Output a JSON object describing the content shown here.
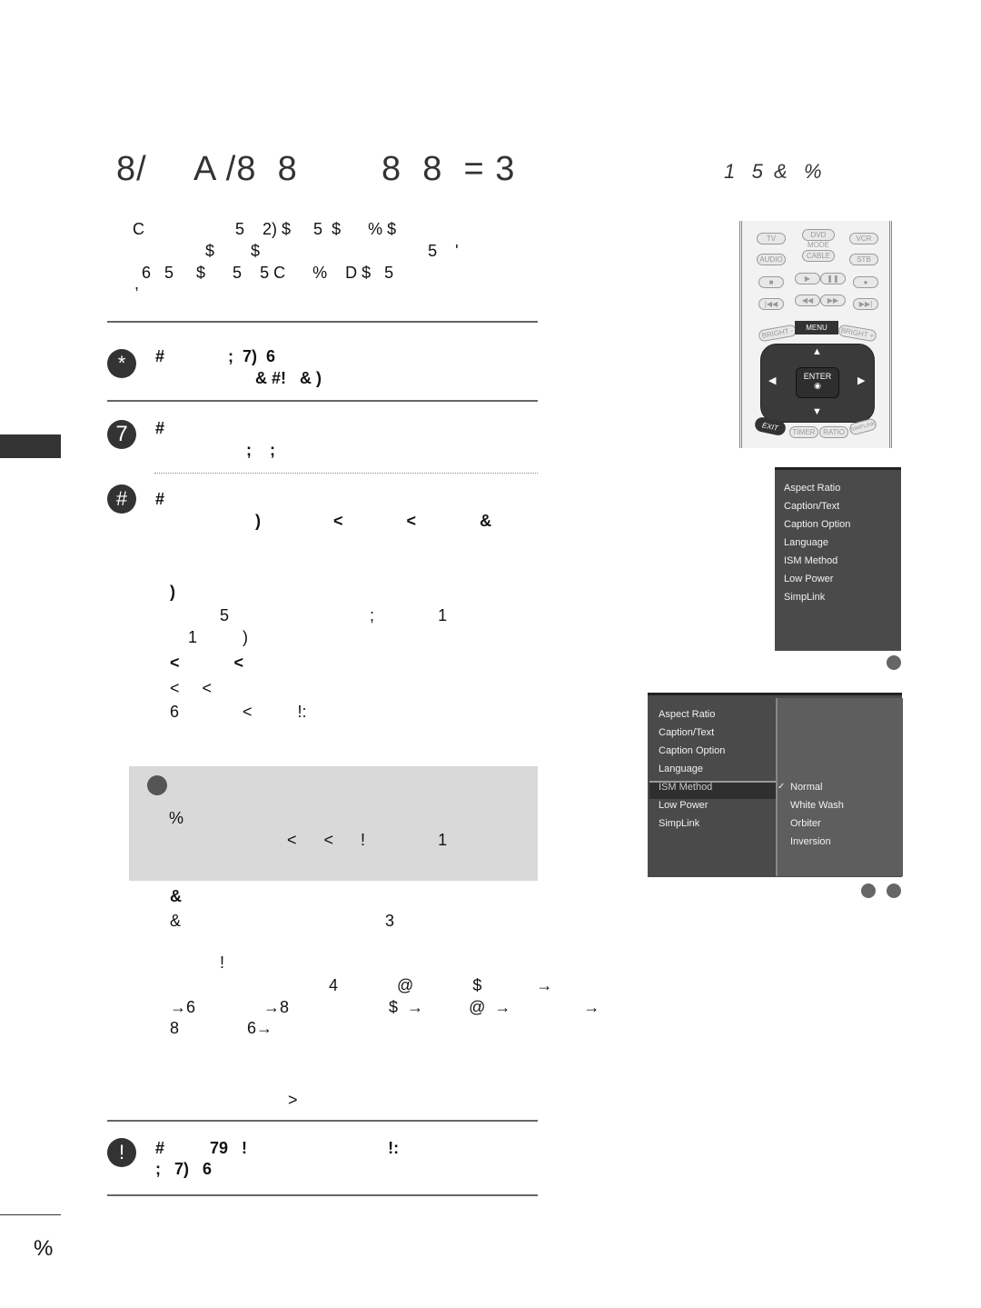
{
  "page": {
    "title_fragments": [
      "8/",
      "A /8  8",
      "8  8  = 3"
    ],
    "subtitle": "1   5  &   %",
    "intro_lines": [
      "C                    5    2) $     5  $      % $",
      "                $        $                                     5    '",
      "  6   5     $      5    5 C      %    D $   5",
      ","
    ],
    "steps": [
      {
        "badge": "*",
        "lines": [
          "#              ;  7)  6",
          "                      & #!   & )"
        ]
      },
      {
        "badge": "7",
        "lines": [
          "#",
          "                    ;    ;"
        ]
      },
      {
        "badge": "#",
        "lines": [
          "#",
          "                      )                <              <              &"
        ]
      }
    ],
    "step3_details": [
      ")",
      "           5                               ;              1",
      "    1          )",
      "<            <",
      "<     <",
      "6              <          !:"
    ],
    "note": {
      "lines": [
        "%",
        "                          <      <      !                1"
      ]
    },
    "after_note": [
      "&",
      "&                                             3",
      "",
      "           !",
      "                                   4             @             $            →",
      "→6               →8                      $  →          @  →                →",
      "8               6→"
    ],
    "tail_line": "                          >",
    "final_step": {
      "badge": "!",
      "lines": [
        "#          79   !                               !:",
        ";   7)   6"
      ]
    },
    "page_number": "%"
  },
  "remote": {
    "mode_label": "MODE",
    "buttons_row1": [
      "TV",
      "DVD",
      "VCR"
    ],
    "buttons_row2": [
      "AUDIO",
      "CABLE",
      "STB"
    ],
    "transport_row1": [
      "■",
      "▶",
      "❚❚",
      "●"
    ],
    "transport_row2": [
      "|◀◀",
      "◀◀",
      "▶▶",
      "▶▶|"
    ],
    "bright_minus": "BRIGHT -",
    "menu": "MENU",
    "bright_plus": "BRIGHT +",
    "enter": "ENTER",
    "enter_symbol": "◉",
    "arrows": {
      "up": "▲",
      "down": "▼",
      "left": "◀",
      "right": "▶"
    },
    "exit": "EXIT",
    "timer": "TIMER",
    "ratio": "RATIO",
    "simplink": "SIMPLINK"
  },
  "osd_menu_1": {
    "items": [
      "Aspect Ratio",
      "Caption/Text",
      "Caption Option",
      "Language",
      "ISM Method",
      "Low Power",
      "SimpLink"
    ]
  },
  "osd_menu_2": {
    "items": [
      "Aspect Ratio",
      "Caption/Text",
      "Caption Option",
      "Language",
      "ISM Method",
      "Low Power",
      "SimpLink"
    ],
    "selected_item": "ISM Method",
    "options": [
      "Normal",
      "White Wash",
      "Orbiter",
      "Inversion"
    ],
    "checked_option": "Normal",
    "check_symbol": "✓"
  }
}
